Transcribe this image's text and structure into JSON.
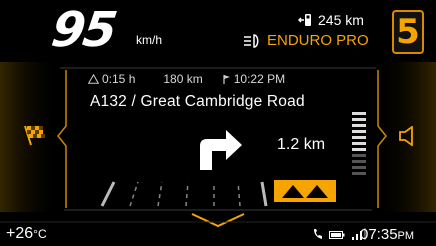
{
  "speed": {
    "value": "95",
    "unit": "km/h"
  },
  "range": {
    "icon": "fuel-pump-icon",
    "value": "245 km"
  },
  "riding_mode": {
    "icon": "headlight-icon",
    "label": "ENDURO PRO"
  },
  "gear": "5",
  "navigation": {
    "eta_duration": "0:15 h",
    "eta_distance": "180 km",
    "eta_arrival": "10:22 PM",
    "road": "A132 / Great Cambridge Road",
    "turn_distance": "1.2 km",
    "turn_direction": "right-turn-arrow-icon"
  },
  "status_bar": {
    "temperature": "+26",
    "temperature_unit": "°C",
    "time": "07:35",
    "time_suffix": "PM"
  },
  "colors": {
    "accent": "#f5a400",
    "background": "#000000",
    "text": "#ffffff"
  }
}
